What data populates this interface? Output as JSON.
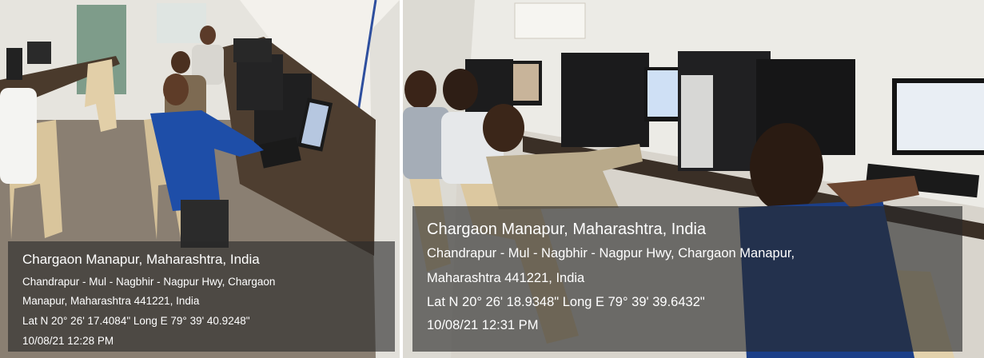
{
  "photos": [
    {
      "place": "Chargaon Manapur, Maharashtra, India",
      "address_line1": "Chandrapur - Mul - Nagbhir - Nagpur Hwy, Chargaon",
      "address_line2": "Manapur, Maharashtra 441221, India",
      "coordinates": "Lat N 20° 26' 17.4084\" Long E 79° 39' 40.9248\"",
      "timestamp": "10/08/21 12:28 PM"
    },
    {
      "place": "Chargaon Manapur, Maharashtra, India",
      "address_line1": "Chandrapur - Mul - Nagbhir - Nagpur Hwy, Chargaon Manapur,",
      "address_line2": "Maharashtra 441221, India",
      "coordinates": "Lat N 20° 26' 18.9348\" Long E 79° 39' 39.6432\"",
      "timestamp": "10/08/21 12:31 PM"
    }
  ]
}
